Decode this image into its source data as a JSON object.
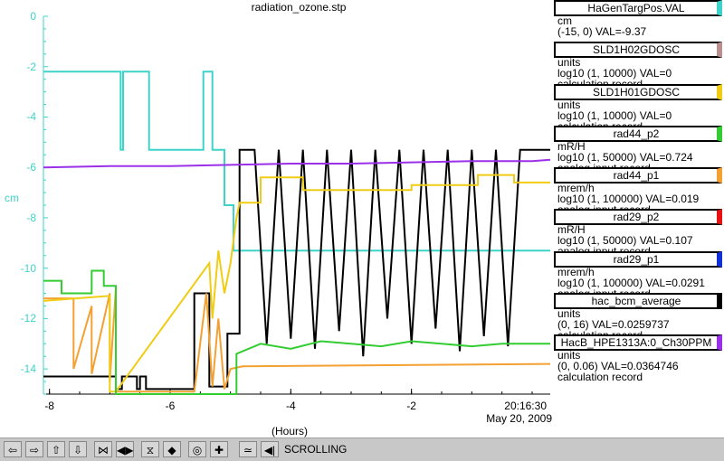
{
  "plot": {
    "title": "radiation_ozone.stp",
    "y_unit": "cm",
    "x_unit": "(Hours)",
    "timestamp_time": "20:16:30",
    "timestamp_date": "May 20, 2009"
  },
  "chart_data": {
    "type": "line",
    "title": "radiation_ozone.stp",
    "xlabel": "(Hours)",
    "ylabel": "cm",
    "xlim": [
      -8.1,
      0.3
    ],
    "ylim": [
      -15,
      0
    ],
    "x_ticks": [
      "-8",
      "-6",
      "-4",
      "-2"
    ],
    "y_ticks": [
      "0",
      "-2",
      "-4",
      "-6",
      "-8",
      "-10",
      "-12",
      "-14"
    ],
    "series": [
      {
        "name": "HaGenTargPos.VAL",
        "color": "#3ed3c8",
        "x": [
          -8.1,
          -6.82,
          -6.82,
          -6.78,
          -6.78,
          -6.35,
          -6.35,
          -5.45,
          -5.45,
          -5.3,
          -5.3,
          -5.1,
          -5.1,
          -4.95,
          -4.95,
          0.3
        ],
        "y": [
          -2.2,
          -2.2,
          -5.3,
          -5.3,
          -2.2,
          -2.2,
          -5.3,
          -5.3,
          -2.2,
          -2.2,
          -5.3,
          -5.3,
          -7.5,
          -7.5,
          -9.3,
          -9.3
        ]
      },
      {
        "name": "rad29_p1",
        "color": "#000000",
        "x": [
          -8.1,
          -6.9,
          -6.9,
          -6.8,
          -6.8,
          -6.55,
          -6.55,
          -6.5,
          -6.5,
          -6.4,
          -6.4,
          -5.6,
          -5.6,
          -5.35,
          -5.35,
          -5.05,
          -5.05,
          -4.85,
          -4.85,
          -4.6,
          -4.4,
          -4.2,
          -4.0,
          -3.8,
          -3.6,
          -3.4,
          -3.2,
          -3.0,
          -2.8,
          -2.6,
          -2.4,
          -2.2,
          -2.0,
          -1.8,
          -1.6,
          -1.4,
          -1.2,
          -1.0,
          -0.8,
          -0.6,
          -0.4,
          -0.2,
          0.0,
          0.3
        ],
        "y": [
          -14.3,
          -14.3,
          -14.8,
          -14.8,
          -14.3,
          -14.3,
          -14.8,
          -14.8,
          -14.3,
          -14.3,
          -14.8,
          -14.8,
          -11.0,
          -11.0,
          -14.7,
          -14.7,
          -12.6,
          -12.6,
          -5.3,
          -5.3,
          -13.0,
          -5.3,
          -12.8,
          -5.3,
          -13.2,
          -5.3,
          -12.5,
          -5.3,
          -13.5,
          -5.3,
          -12.0,
          -5.3,
          -13.0,
          -5.3,
          -12.4,
          -5.3,
          -13.3,
          -5.3,
          -12.7,
          -5.3,
          -13.1,
          -5.3,
          -5.3,
          -5.3
        ]
      },
      {
        "name": "rad44_p1",
        "color": "#f4a032",
        "x": [
          -8.1,
          -7.6,
          -7.6,
          -7.3,
          -7.3,
          -7.0,
          -7.0,
          -6.9,
          -6.9,
          -5.6,
          -5.4,
          -5.3,
          -5.2,
          -5.1,
          -5.0,
          -4.8,
          0.3
        ],
        "y": [
          -11.2,
          -11.2,
          -14.0,
          -11.5,
          -14.2,
          -11.0,
          -14.5,
          -10.8,
          -14.9,
          -14.9,
          -11.0,
          -14.7,
          -12.0,
          -14.8,
          -14.0,
          -13.9,
          -13.8
        ]
      },
      {
        "name": "SLD1H01GDOSC",
        "color": "#f0cc14",
        "x": [
          -8.1,
          -7.0,
          -7.0,
          -6.9,
          -5.35,
          -5.3,
          -5.2,
          -5.1,
          -5.0,
          -4.9,
          -4.85,
          -4.5,
          -4.5,
          -3.8,
          -3.8,
          -2.0,
          -2.0,
          -0.9,
          -0.9,
          -0.3,
          -0.3,
          0.3
        ],
        "y": [
          -11.3,
          -11.1,
          -14.9,
          -14.9,
          -9.8,
          -12.0,
          -9.3,
          -11.0,
          -9.8,
          -8.0,
          -7.4,
          -7.4,
          -6.4,
          -6.4,
          -6.9,
          -6.9,
          -6.7,
          -6.7,
          -6.3,
          -6.3,
          -6.6,
          -6.6
        ]
      },
      {
        "name": "rad44_p2",
        "color": "#33cc33",
        "x": [
          -8.1,
          -7.8,
          -7.8,
          -7.3,
          -7.3,
          -7.1,
          -7.1,
          -6.9,
          -6.9,
          -4.9,
          -4.9,
          -4.5,
          -4.0,
          -3.5,
          -3.0,
          -2.5,
          -2.0,
          -1.5,
          -1.0,
          -0.5,
          0.0,
          0.3
        ],
        "y": [
          -10.5,
          -10.5,
          -11.0,
          -11.0,
          -10.1,
          -10.1,
          -10.7,
          -10.7,
          -15.0,
          -15.0,
          -13.4,
          -13.0,
          -13.2,
          -12.9,
          -13.0,
          -13.1,
          -12.9,
          -13.0,
          -13.1,
          -13.0,
          -13.0,
          -13.0
        ]
      },
      {
        "name": "HacB_HPE1313A:0_Ch30PPM",
        "color": "#9a30e8",
        "x": [
          -8.1,
          -7.0,
          -6.0,
          -5.0,
          -4.0,
          -3.0,
          -2.0,
          -1.0,
          0.0,
          0.3
        ],
        "y": [
          -6.0,
          -5.95,
          -5.95,
          -5.9,
          -5.85,
          -5.85,
          -5.8,
          -5.75,
          -5.75,
          -5.7
        ]
      }
    ]
  },
  "legend": [
    {
      "name": "HaGenTargPos.VAL",
      "color": "#3ed3c8",
      "line1": "cm",
      "line2": "(-15, 0) VAL=-9.37",
      "line3": ""
    },
    {
      "name": "SLD1H02GDOSC",
      "color": "#b89090",
      "line1": "units",
      "line2": "log10 (1, 10000) VAL=0",
      "line3": "calculation record"
    },
    {
      "name": "SLD1H01GDOSC",
      "color": "#f0cc14",
      "line1": "units",
      "line2": "log10 (1, 10000) VAL=0",
      "line3": "calculation record"
    },
    {
      "name": "rad44_p2",
      "color": "#33cc33",
      "line1": "mR/H",
      "line2": "log10 (1, 50000) VAL=0.724",
      "line3": "analog input record"
    },
    {
      "name": "rad44_p1",
      "color": "#f4a032",
      "line1": "mrem/h",
      "line2": "log10 (1, 100000) VAL=0.019",
      "line3": "analog input record"
    },
    {
      "name": "rad29_p2",
      "color": "#e81010",
      "line1": "mR/H",
      "line2": "log10 (1, 50000) VAL=0.107",
      "line3": "analog input record"
    },
    {
      "name": "rad29_p1",
      "color": "#1030d8",
      "line1": "mrem/h",
      "line2": "log10 (1, 100000) VAL=0.0291",
      "line3": "analog input record"
    },
    {
      "name": "hac_bcm_average",
      "color": "#000000",
      "line1": "units",
      "line2": "(0, 16) VAL=0.0259737",
      "line3": "calculation record"
    },
    {
      "name": "HacB_HPE1313A:0_Ch30PPM",
      "color": "#9a30e8",
      "line1": "units",
      "line2": "(0, 0.06) VAL=0.0364746",
      "line3": "calculation record"
    }
  ],
  "toolbar": {
    "buttons": [
      {
        "icon": "arrow-left-icon",
        "glyph": "⇦"
      },
      {
        "icon": "arrow-right-icon",
        "glyph": "⇨"
      },
      {
        "icon": "arrow-up-icon",
        "glyph": "⇧"
      },
      {
        "icon": "arrow-down-icon",
        "glyph": "⇩"
      },
      {
        "icon": "zoom-in-horizontal-icon",
        "glyph": "⋈"
      },
      {
        "icon": "zoom-out-horizontal-icon",
        "glyph": "◀▶"
      },
      {
        "icon": "zoom-in-vertical-icon",
        "glyph": "⧖"
      },
      {
        "icon": "zoom-out-vertical-icon",
        "glyph": "◆"
      },
      {
        "icon": "auto-scale-icon",
        "glyph": "◎"
      },
      {
        "icon": "add-icon",
        "glyph": "✚"
      },
      {
        "icon": "scrolling-icon",
        "glyph": "≃"
      },
      {
        "icon": "back-icon",
        "glyph": "◀|"
      }
    ],
    "mode_label": "SCROLLING"
  }
}
